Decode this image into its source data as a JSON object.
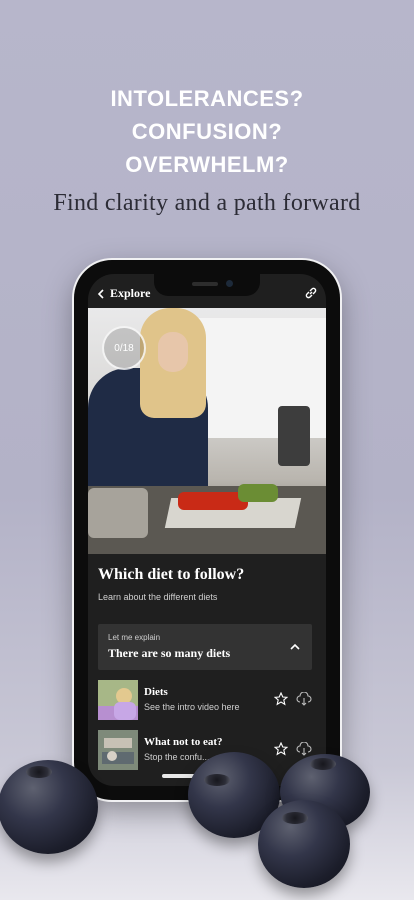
{
  "headline": [
    "INTOLERANCES?",
    "CONFUSION?",
    "OVERWHELM?"
  ],
  "tagline": "Find clarity and a path forward",
  "app": {
    "back_label": "Explore",
    "progress": "0/18",
    "title": "Which diet to follow?",
    "subtitle": "Learn about the different diets",
    "accordion": {
      "small": "Let me explain",
      "big": "There are so many diets"
    },
    "items": [
      {
        "title": "Diets",
        "desc": "See the intro video here"
      },
      {
        "title": "What not to eat?",
        "desc": "Stop the confu..."
      }
    ]
  },
  "icons": {
    "back": "chevron-left-icon",
    "link": "link-icon",
    "accordion": "chevron-up-icon",
    "star": "star-icon",
    "download": "cloud-download-icon"
  },
  "colors": {
    "background": "#b7b6cb",
    "screen": "#1f1f1f",
    "panel": "#333333"
  }
}
